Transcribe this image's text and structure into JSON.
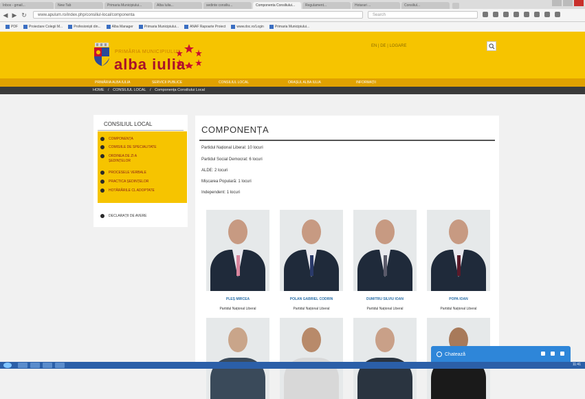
{
  "browser": {
    "tabs": [
      {
        "label": "Inbox - gmail...",
        "active": false
      },
      {
        "label": "New Tab",
        "active": false
      },
      {
        "label": "Primaria Municipiului...",
        "active": false
      },
      {
        "label": "Alba Iulia...",
        "active": false
      },
      {
        "label": "sedinte consiliu...",
        "active": false
      },
      {
        "label": "Componenta Consiliului...",
        "active": true
      },
      {
        "label": "Regulament...",
        "active": false
      },
      {
        "label": "Hotarari ...",
        "active": false
      },
      {
        "label": "Consiliul...",
        "active": false
      }
    ],
    "url": "www.apulum.ro/index.php/consiliul-local/componenta",
    "search_placeholder": "Search",
    "bookmarks": [
      "PDF",
      "Proiectare Colegii M...",
      "Profesioniști din...",
      "Alba Manager",
      "Primaria Municipiului...",
      "ANAF Rapoarte Proiect",
      "www.doc.ro/Login",
      "Primaria Municipiului..."
    ]
  },
  "site": {
    "logo_small": "PRIMĂRIA MUNICIPIULUI",
    "logo_big": "alba iulia",
    "lang": "EN  |  DE  |  LOGARE",
    "nav": [
      "PRIMĂRIA ALBA IULIA",
      "SERVICII PUBLICE",
      "CONSILIUL LOCAL",
      "ORAȘUL ALBA IULIA",
      "INFORMAȚII"
    ],
    "breadcrumb": [
      "HOME",
      "/",
      "CONSILIUL LOCAL",
      "/",
      "Componența Consiliului Local"
    ]
  },
  "sidebar": {
    "title": "CONSILIUL LOCAL",
    "items": [
      "COMPONENȚA",
      "COMISIILE DE SPECIALITATE",
      "ORDINEA DE ZI A ȘEDINȚELOR",
      "PROCESELE VERBALE",
      "PRACTICA ȘEDINȚELOR",
      "HOTĂRÂRILE CL ADOPTATE"
    ],
    "extra_item": "DECLARAȚII DE AVERE"
  },
  "main": {
    "title": "COMPONENȚA",
    "parties": [
      "Partidul Național Liberal: 10 locuri",
      "Partidul Social Democrat: 6 locuri",
      "ALDE: 2 locuri",
      "Mișcarea Populară: 1 locuri",
      "Independent: 1 locuri"
    ],
    "members": [
      {
        "name": "PLEȘ MIRCEA",
        "party": "Partidul Național Liberal",
        "tie": "#d9869e"
      },
      {
        "name": "POLAN GABRIEL CODRIN",
        "party": "Partidul Național Liberal",
        "tie": "#2a3a6a"
      },
      {
        "name": "DUMITRU SILVIU IOAN",
        "party": "Partidul Național Liberal",
        "tie": "#5a5a6a"
      },
      {
        "name": "POPA IOAN",
        "party": "Partidul Național Liberal",
        "tie": "#5a1a2a"
      }
    ]
  },
  "chat": {
    "label": "Chatează"
  },
  "taskbar": {
    "clock": "11:41"
  }
}
